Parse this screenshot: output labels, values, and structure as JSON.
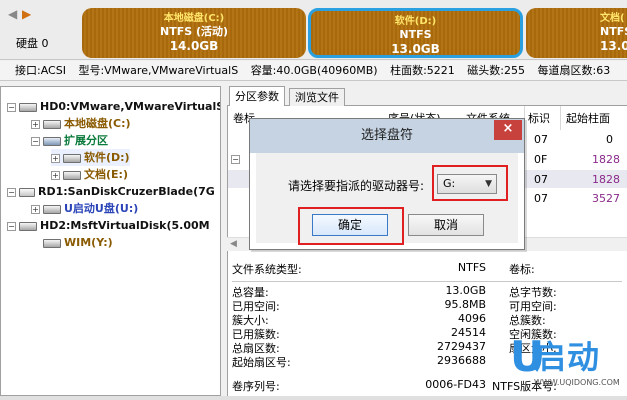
{
  "topbar": {
    "disk_label": "硬盘 0",
    "partitions": [
      {
        "name": "本地磁盘(C:)",
        "fs": "NTFS (活动)",
        "size": "14.0GB"
      },
      {
        "name": "软件(D:)",
        "fs": "NTFS",
        "size": "13.0GB"
      },
      {
        "name": "文档(",
        "fs": "NTFS",
        "size": "13.0"
      }
    ]
  },
  "infoline": {
    "iface": "接口:ACSI",
    "model": "型号:VMware,VMwareVirtualS",
    "capacity": "容量:40.0GB(40960MB)",
    "cyl": "柱面数:5221",
    "heads": "磁头数:255",
    "spt": "每道扇区数:63"
  },
  "tree": [
    {
      "label": "HD0:VMware,VMwareVirtualS"
    },
    {
      "label": "本地磁盘(C:)"
    },
    {
      "label": "扩展分区"
    },
    {
      "label": "软件(D:)"
    },
    {
      "label": "文档(E:)"
    },
    {
      "label": "RD1:SanDiskCruzerBlade(7G"
    },
    {
      "label": "U启动U盘(U:)"
    },
    {
      "label": "HD2:MsftVirtualDisk(5.00M"
    },
    {
      "label": "WIM(Y:)"
    }
  ],
  "tabs": [
    "分区参数",
    "浏览文件"
  ],
  "table": {
    "headers": [
      "卷标",
      "序号(状态)",
      "文件系统",
      "标识",
      "起始柱面"
    ],
    "rows": [
      {
        "id": "07",
        "cyl": "0"
      },
      {
        "id": "0F",
        "cyl": "1828"
      },
      {
        "id": "07",
        "cyl": "1828"
      },
      {
        "id": "07",
        "cyl": "3527"
      }
    ]
  },
  "details": {
    "fs_type_label": "文件系统类型:",
    "fs_type": "NTFS",
    "vol_label": "卷标:",
    "rows": [
      {
        "label": "总容量:",
        "value": "13.0GB",
        "right": "总字节数:"
      },
      {
        "label": "已用空间:",
        "value": "95.8MB",
        "right": "可用空间:"
      },
      {
        "label": "簇大小:",
        "value": "4096",
        "right": "总簇数:"
      },
      {
        "label": "已用簇数:",
        "value": "24514",
        "right": "空闲簇数:"
      },
      {
        "label": "总扇区数:",
        "value": "2729437",
        "right": "扇区大小:"
      },
      {
        "label": "起始扇区号:",
        "value": "2936688",
        "right": ""
      }
    ],
    "serial_label": "卷序列号:",
    "serial": "0006-FD43",
    "ntfs_label": "NTFS版本号:"
  },
  "dialog": {
    "title": "选择盘符",
    "close": "×",
    "prompt": "请选择要指派的驱动器号:",
    "selected_drive": "G:",
    "ok": "确定",
    "cancel": "取消"
  },
  "logo": {
    "mark": "U",
    "text": "启动",
    "url": "WWW.UQIDONG.COM"
  },
  "colors": {
    "partition": "#a86408",
    "selected_partition_border": "#2aa0e0",
    "highlight_box": "#e02020",
    "dialog_title": "#c5d3e3",
    "logo": "#2f8fe0"
  }
}
